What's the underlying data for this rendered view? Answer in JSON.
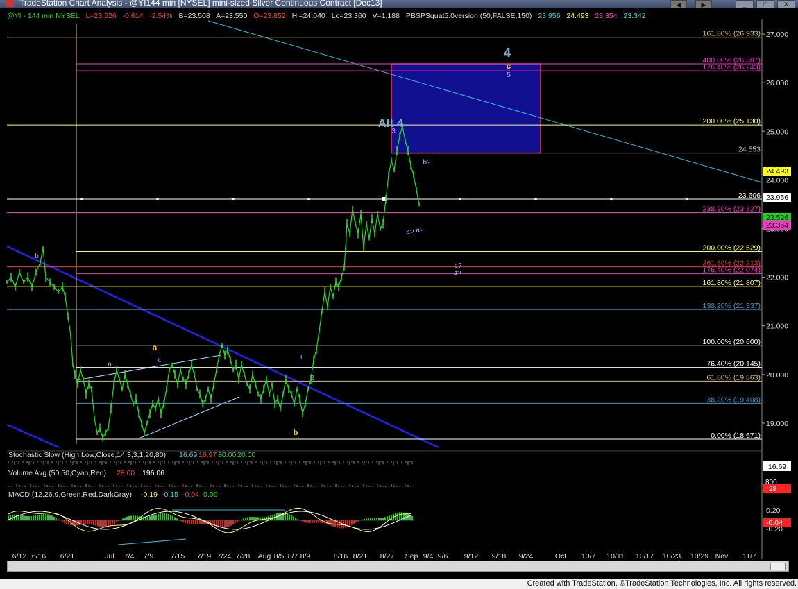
{
  "window": {
    "title": "TradeStation Chart Analysis - @YI144 min [NYSEL] mini-sized Silver Continuous Contract [Dec13]"
  },
  "header": {
    "symbol": "@YI - 144 min  NYSEL",
    "last": "L=23.526",
    "change": "-0.614",
    "pct": "-2.54%",
    "bid": "B=23.508",
    "ask": "A=23.550",
    "open": "O=23.852",
    "high": "Hi=24.040",
    "low": "Lo=23.360",
    "volume": "V=1,188",
    "study": "PBSPSquat5.0version (50,FALSE,150)",
    "v1": "23.956",
    "v2": "24.493",
    "v3": "23.354",
    "v4": "23.342"
  },
  "footer": {
    "credit": "Created with TradeStation. ©TradeStation Technologies, Inc. All rights reserved."
  },
  "chart_data": {
    "type": "line",
    "title": "@YI - 144 min NYSEL",
    "price_ylim": [
      18.5,
      27.3
    ],
    "y_ticks": [
      19,
      20,
      21,
      22,
      23,
      24,
      25,
      26,
      27
    ],
    "y_tick_labels": [
      "19.000",
      "20.000",
      "21.000",
      "22.000",
      "23.000",
      "24.000",
      "25.000",
      "26.000",
      "27.000"
    ],
    "x_tick_labels": [
      "6/12",
      "6/16",
      "6/21",
      "Jul",
      "7/4",
      "7/9",
      "7/15",
      "7/19",
      "7/24",
      "7/28",
      "Aug",
      "8/5",
      "8/7",
      "8/9",
      "8/16",
      "8/21",
      "8/27",
      "Sep",
      "9/4",
      "9/6",
      "9/12",
      "9/18",
      "9/24",
      "Oct",
      "10/7",
      "10/11",
      "10/17",
      "10/23",
      "10/29",
      "Nov",
      "11/7"
    ],
    "series": [
      {
        "name": "@YI",
        "color": "#22dd22",
        "points": [
          [
            0,
            21.9
          ],
          [
            6,
            22.0
          ],
          [
            12,
            21.8
          ],
          [
            18,
            22.1
          ],
          [
            24,
            21.9
          ],
          [
            30,
            22.0
          ],
          [
            36,
            21.8
          ],
          [
            42,
            22.1
          ],
          [
            48,
            22.3
          ],
          [
            52,
            22.6
          ],
          [
            56,
            22.0
          ],
          [
            62,
            21.9
          ],
          [
            68,
            21.8
          ],
          [
            74,
            21.7
          ],
          [
            80,
            21.8
          ],
          [
            84,
            21.6
          ],
          [
            88,
            21.2
          ],
          [
            92,
            20.8
          ],
          [
            95,
            20.2
          ],
          [
            98,
            20.0
          ],
          [
            102,
            19.8
          ],
          [
            106,
            20.1
          ],
          [
            110,
            19.9
          ],
          [
            114,
            19.6
          ],
          [
            118,
            19.8
          ],
          [
            122,
            19.7
          ],
          [
            126,
            19.1
          ],
          [
            130,
            18.8
          ],
          [
            134,
            18.9
          ],
          [
            138,
            18.7
          ],
          [
            142,
            18.8
          ],
          [
            146,
            18.9
          ],
          [
            150,
            19.3
          ],
          [
            154,
            19.8
          ],
          [
            158,
            20.1
          ],
          [
            162,
            19.9
          ],
          [
            166,
            19.7
          ],
          [
            170,
            20.0
          ],
          [
            174,
            19.8
          ],
          [
            178,
            19.6
          ],
          [
            182,
            19.4
          ],
          [
            186,
            19.5
          ],
          [
            190,
            19.2
          ],
          [
            194,
            19.0
          ],
          [
            198,
            18.8
          ],
          [
            202,
            19.0
          ],
          [
            206,
            19.2
          ],
          [
            210,
            19.4
          ],
          [
            214,
            19.3
          ],
          [
            218,
            19.5
          ],
          [
            222,
            19.2
          ],
          [
            226,
            19.4
          ],
          [
            230,
            19.7
          ],
          [
            234,
            20.1
          ],
          [
            238,
            20.2
          ],
          [
            242,
            20.0
          ],
          [
            246,
            19.8
          ],
          [
            250,
            20.1
          ],
          [
            254,
            19.9
          ],
          [
            258,
            19.8
          ],
          [
            262,
            20.0
          ],
          [
            266,
            20.2
          ],
          [
            270,
            20.0
          ],
          [
            274,
            19.7
          ],
          [
            278,
            19.6
          ],
          [
            282,
            19.4
          ],
          [
            286,
            19.5
          ],
          [
            290,
            19.7
          ],
          [
            294,
            19.5
          ],
          [
            298,
            19.8
          ],
          [
            302,
            20.1
          ],
          [
            306,
            20.4
          ],
          [
            310,
            20.6
          ],
          [
            314,
            20.4
          ],
          [
            318,
            20.5
          ],
          [
            322,
            20.3
          ],
          [
            326,
            20.1
          ],
          [
            330,
            20.2
          ],
          [
            334,
            19.9
          ],
          [
            338,
            20.2
          ],
          [
            342,
            20.0
          ],
          [
            346,
            19.8
          ],
          [
            350,
            19.7
          ],
          [
            354,
            20.0
          ],
          [
            358,
            19.8
          ],
          [
            362,
            19.6
          ],
          [
            366,
            19.5
          ],
          [
            370,
            19.7
          ],
          [
            374,
            19.9
          ],
          [
            378,
            19.6
          ],
          [
            382,
            19.8
          ],
          [
            386,
            19.4
          ],
          [
            390,
            19.5
          ],
          [
            394,
            19.3
          ],
          [
            398,
            19.6
          ],
          [
            402,
            19.9
          ],
          [
            406,
            19.7
          ],
          [
            410,
            19.6
          ],
          [
            414,
            19.4
          ],
          [
            418,
            19.7
          ],
          [
            422,
            19.5
          ],
          [
            426,
            19.2
          ],
          [
            430,
            19.4
          ],
          [
            434,
            19.7
          ],
          [
            438,
            19.9
          ],
          [
            442,
            20.3
          ],
          [
            446,
            20.5
          ],
          [
            450,
            20.9
          ],
          [
            454,
            21.3
          ],
          [
            458,
            21.7
          ],
          [
            462,
            21.4
          ],
          [
            466,
            21.8
          ],
          [
            470,
            21.6
          ],
          [
            474,
            21.9
          ],
          [
            478,
            21.8
          ],
          [
            482,
            22.0
          ],
          [
            486,
            22.2
          ],
          [
            488,
            22.6
          ],
          [
            490,
            23.1
          ],
          [
            494,
            22.9
          ],
          [
            498,
            23.4
          ],
          [
            502,
            23.1
          ],
          [
            506,
            22.9
          ],
          [
            510,
            23.3
          ],
          [
            514,
            22.6
          ],
          [
            518,
            23.1
          ],
          [
            522,
            22.8
          ],
          [
            526,
            23.2
          ],
          [
            530,
            22.9
          ],
          [
            534,
            23.3
          ],
          [
            538,
            23.0
          ],
          [
            542,
            23.1
          ],
          [
            546,
            23.6
          ],
          [
            550,
            24.1
          ],
          [
            554,
            24.4
          ],
          [
            558,
            24.2
          ],
          [
            562,
            24.6
          ],
          [
            566,
            24.9
          ],
          [
            570,
            25.1
          ],
          [
            574,
            24.8
          ],
          [
            578,
            24.6
          ],
          [
            582,
            24.3
          ],
          [
            586,
            24.1
          ],
          [
            590,
            23.8
          ],
          [
            594,
            23.5
          ]
        ]
      }
    ],
    "horizontal_levels": [
      {
        "label": "161.80% (26.933)",
        "value": 26.933,
        "color": "#d8c27a"
      },
      {
        "label": "400.00% (26.387)",
        "value": 26.387,
        "color": "#ff33cc"
      },
      {
        "label": "176.40% (26.243)",
        "value": 26.243,
        "color": "#ff33cc"
      },
      {
        "label": "200.00% (25.130)",
        "value": 25.13,
        "color": "#ffff55"
      },
      {
        "label": "24.553",
        "value": 24.553,
        "color": "#cccccc"
      },
      {
        "label": "23.606",
        "value": 23.606,
        "color": "#ffffff"
      },
      {
        "label": "238.20% (23.327)",
        "value": 23.327,
        "color": "#ff33cc"
      },
      {
        "label": "200.00% (22.529)",
        "value": 22.529,
        "color": "#ffff55"
      },
      {
        "label": "261.80% (22.213)",
        "value": 22.213,
        "color": "#ff3333"
      },
      {
        "label": "176.40% (22.074)",
        "value": 22.074,
        "color": "#ff33cc"
      },
      {
        "label": "161.80% (21.807)",
        "value": 21.807,
        "color": "#ffff55"
      },
      {
        "label": "138.20% (21.337)",
        "value": 21.337,
        "color": "#3399cc"
      },
      {
        "label": "100.00% (20.600)",
        "value": 20.6,
        "color": "#ffffff"
      },
      {
        "label": "76.40% (20.145)",
        "value": 20.145,
        "color": "#ffffff"
      },
      {
        "label": "61.80% (19.863)",
        "value": 19.863,
        "color": "#d8c27a"
      },
      {
        "label": "38.20% (19.408)",
        "value": 19.408,
        "color": "#3399cc"
      },
      {
        "label": "0.00% (18.671)",
        "value": 18.671,
        "color": "#ffffff"
      }
    ],
    "target_box": {
      "top": 26.387,
      "bottom": 24.553
    },
    "wave_labels": [
      {
        "text": "4",
        "color": "#88aacc"
      },
      {
        "text": "c",
        "color": "#ffdd00"
      },
      {
        "text": "5",
        "color": "#aaaaff"
      },
      {
        "text": "Alt 4",
        "color": "#88aacc"
      },
      {
        "text": "3",
        "color": "#aaaaff"
      },
      {
        "text": "b?",
        "color": "#aaaaff"
      },
      {
        "text": "4?",
        "color": "#aaaaff"
      },
      {
        "text": "a?",
        "color": "#aaaaff"
      },
      {
        "text": "c?",
        "color": "#aaaaff"
      },
      {
        "text": "4?",
        "color": "#aaaaff"
      },
      {
        "text": "b",
        "color": "#aaaaff"
      },
      {
        "text": "a",
        "color": "#ffdd00"
      },
      {
        "text": "a",
        "color": "#aaaaff"
      },
      {
        "text": "c",
        "color": "#aaaaff"
      },
      {
        "text": "1",
        "color": "#aaaaff"
      },
      {
        "text": "2",
        "color": "#aaaaff"
      },
      {
        "text": "b",
        "color": "#ffdd00"
      }
    ],
    "right_tags": [
      {
        "value": "24.493",
        "bg": "#ffff00",
        "fg": "#000000"
      },
      {
        "value": "23.956",
        "bg": "#ffffff",
        "fg": "#000000"
      },
      {
        "value": "23.526",
        "bg": "#22cc22",
        "fg": "#000000"
      },
      {
        "value": "23.354",
        "bg": "#ff33cc",
        "fg": "#000000"
      }
    ],
    "stochastic": {
      "label": "Stochastic Slow (High,Low,Close,14,3,3,1,20,80)",
      "values": [
        "16.69",
        "16.97",
        "80.00",
        "20.00"
      ],
      "tag": "16.69"
    },
    "volume": {
      "label": "Volume Avg (50,50,Cyan,Red)",
      "values": [
        "28.00",
        "196.06"
      ],
      "tags": [
        "800",
        "28"
      ]
    },
    "macd": {
      "label": "MACD (12,26,9,Green,Red,DarkGray)",
      "values": [
        "-0.19",
        "-0.15",
        "-0.04",
        "0.00"
      ],
      "tag": "-0.04",
      "ticks": [
        "0.20",
        "-0.20"
      ]
    }
  }
}
